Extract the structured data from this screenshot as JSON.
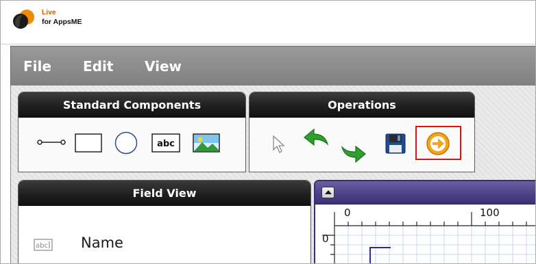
{
  "logo": {
    "live": "Live",
    "sub": "for AppsME"
  },
  "menu": {
    "file": "File",
    "edit": "Edit",
    "view": "View"
  },
  "panels": {
    "standard_components": {
      "title": "Standard Components",
      "tools": [
        "connector-icon",
        "rectangle-icon",
        "circle-icon",
        "text-label-icon",
        "image-icon"
      ]
    },
    "operations": {
      "title": "Operations",
      "tools": [
        "select-pointer-icon",
        "undo-icon",
        "redo-icon",
        "save-icon",
        "run-arrow-icon"
      ]
    },
    "field_view": {
      "title": "Field View",
      "items": [
        {
          "icon": "text-field-icon",
          "icon_text": "abc",
          "label": "Name"
        }
      ]
    }
  },
  "canvas": {
    "ruler_top": [
      "0",
      "100"
    ],
    "ruler_left": [
      "0"
    ]
  },
  "colors": {
    "menubar": "#8c8c8c",
    "panel_title": "#1e1e1e",
    "canvas_titlebar": "#4b3f86",
    "highlight": "#e01010",
    "logo_orange": "#d45a00"
  }
}
